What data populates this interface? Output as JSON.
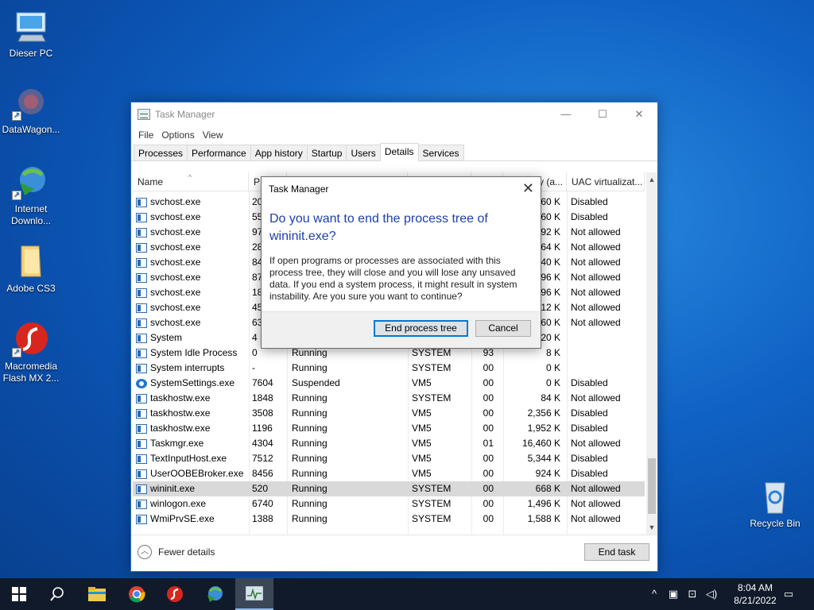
{
  "desktop": {
    "icons": [
      {
        "label": "Dieser PC"
      },
      {
        "label": "DataWagon..."
      },
      {
        "label": "Internet Downlo..."
      },
      {
        "label": "Adobe CS3"
      },
      {
        "label": "Macromedia Flash MX 2..."
      },
      {
        "label": "Recycle Bin"
      }
    ]
  },
  "window": {
    "title": "Task Manager",
    "menu": [
      "File",
      "Options",
      "View"
    ],
    "tabs": [
      "Processes",
      "Performance",
      "App history",
      "Startup",
      "Users",
      "Details",
      "Services"
    ],
    "active_tab": "Details",
    "columns": {
      "name": "Name",
      "pid": "PI",
      "uac": "UAC virtualizat...",
      "memory_partial": "y (a..."
    },
    "rows": [
      {
        "name": "svchost.exe",
        "pid": "20",
        "status": "",
        "user": "",
        "cpu": "",
        "mem": "60 K",
        "uac": "Disabled"
      },
      {
        "name": "svchost.exe",
        "pid": "55",
        "status": "",
        "user": "",
        "cpu": "",
        "mem": "60 K",
        "uac": "Disabled"
      },
      {
        "name": "svchost.exe",
        "pid": "97",
        "status": "",
        "user": "",
        "cpu": "",
        "mem": "92 K",
        "uac": "Not allowed"
      },
      {
        "name": "svchost.exe",
        "pid": "28",
        "status": "",
        "user": "",
        "cpu": "",
        "mem": "64 K",
        "uac": "Not allowed"
      },
      {
        "name": "svchost.exe",
        "pid": "84",
        "status": "",
        "user": "",
        "cpu": "",
        "mem": "40 K",
        "uac": "Not allowed"
      },
      {
        "name": "svchost.exe",
        "pid": "87",
        "status": "",
        "user": "",
        "cpu": "",
        "mem": "96 K",
        "uac": "Not allowed"
      },
      {
        "name": "svchost.exe",
        "pid": "18",
        "status": "",
        "user": "",
        "cpu": "",
        "mem": "96 K",
        "uac": "Not allowed"
      },
      {
        "name": "svchost.exe",
        "pid": "45",
        "status": "",
        "user": "",
        "cpu": "",
        "mem": "12 K",
        "uac": "Not allowed"
      },
      {
        "name": "svchost.exe",
        "pid": "63",
        "status": "",
        "user": "",
        "cpu": "",
        "mem": "60 K",
        "uac": "Not allowed"
      },
      {
        "name": "System",
        "pid": "4",
        "status": "",
        "user": "",
        "cpu": "",
        "mem": "20 K",
        "uac": ""
      },
      {
        "name": "System Idle Process",
        "pid": "0",
        "status": "Running",
        "user": "SYSTEM",
        "cpu": "93",
        "mem": "8 K",
        "uac": ""
      },
      {
        "name": "System interrupts",
        "pid": "-",
        "status": "Running",
        "user": "SYSTEM",
        "cpu": "00",
        "mem": "0 K",
        "uac": ""
      },
      {
        "name": "SystemSettings.exe",
        "pid": "7604",
        "status": "Suspended",
        "user": "VM5",
        "cpu": "00",
        "mem": "0 K",
        "uac": "Disabled"
      },
      {
        "name": "taskhostw.exe",
        "pid": "1848",
        "status": "Running",
        "user": "SYSTEM",
        "cpu": "00",
        "mem": "84 K",
        "uac": "Not allowed"
      },
      {
        "name": "taskhostw.exe",
        "pid": "3508",
        "status": "Running",
        "user": "VM5",
        "cpu": "00",
        "mem": "2,356 K",
        "uac": "Disabled"
      },
      {
        "name": "taskhostw.exe",
        "pid": "1196",
        "status": "Running",
        "user": "VM5",
        "cpu": "00",
        "mem": "1,952 K",
        "uac": "Disabled"
      },
      {
        "name": "Taskmgr.exe",
        "pid": "4304",
        "status": "Running",
        "user": "VM5",
        "cpu": "01",
        "mem": "16,460 K",
        "uac": "Not allowed"
      },
      {
        "name": "TextInputHost.exe",
        "pid": "7512",
        "status": "Running",
        "user": "VM5",
        "cpu": "00",
        "mem": "5,344 K",
        "uac": "Disabled"
      },
      {
        "name": "UserOOBEBroker.exe",
        "pid": "8456",
        "status": "Running",
        "user": "VM5",
        "cpu": "00",
        "mem": "924 K",
        "uac": "Disabled"
      },
      {
        "name": "wininit.exe",
        "pid": "520",
        "status": "Running",
        "user": "SYSTEM",
        "cpu": "00",
        "mem": "668 K",
        "uac": "Not allowed",
        "selected": true
      },
      {
        "name": "winlogon.exe",
        "pid": "6740",
        "status": "Running",
        "user": "SYSTEM",
        "cpu": "00",
        "mem": "1,496 K",
        "uac": "Not allowed"
      },
      {
        "name": "WmiPrvSE.exe",
        "pid": "1388",
        "status": "Running",
        "user": "SYSTEM",
        "cpu": "00",
        "mem": "1,588 K",
        "uac": "Not allowed"
      }
    ],
    "fewer_details": "Fewer details",
    "end_task": "End task"
  },
  "dialog": {
    "title": "Task Manager",
    "heading": "Do you want to end the process tree of wininit.exe?",
    "body": "If open programs or processes are associated with this process tree, they will close and you will lose any unsaved data. If you end a system process, it might result in system instability. Are you sure you want to continue?",
    "confirm": "End process tree",
    "cancel": "Cancel"
  },
  "taskbar": {
    "time": "8:04 AM",
    "date": "8/21/2022"
  }
}
